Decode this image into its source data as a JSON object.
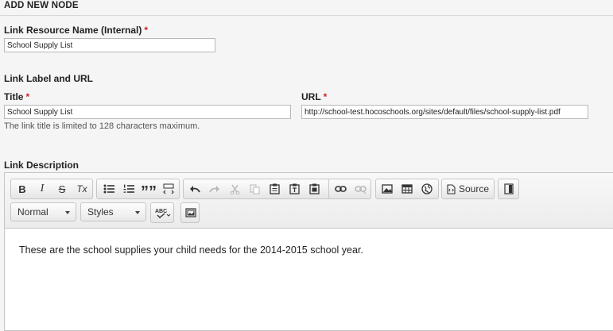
{
  "header": {
    "title": "ADD NEW NODE"
  },
  "resource_name": {
    "label": "Link Resource Name (Internal)",
    "required_mark": "*",
    "value": "School Supply List"
  },
  "link_section": {
    "label": "Link Label and URL"
  },
  "title_field": {
    "label": "Title",
    "required_mark": "*",
    "value": "School Supply List",
    "help": "The link title is limited to 128 characters maximum."
  },
  "url_field": {
    "label": "URL",
    "required_mark": "*",
    "value": "http://school-test.hocoschools.org/sites/default/files/school-supply-list.pdf"
  },
  "description": {
    "label": "Link Description",
    "toolbar": {
      "bold": "B",
      "italic": "I",
      "strike": "S",
      "remove_format": "Tx",
      "blockquote": "””",
      "source_label": "Source",
      "format_value": "Normal",
      "styles_value": "Styles"
    },
    "content": "These are the school supplies your child needs for the 2014-2015 school year."
  },
  "colors": {
    "required": "#cc2222"
  }
}
